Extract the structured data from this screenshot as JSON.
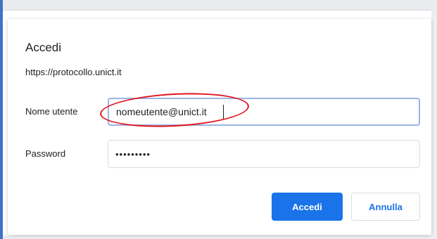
{
  "dialog": {
    "title": "Accedi",
    "origin": "https://protocollo.unict.it",
    "username": {
      "label": "Nome utente",
      "value": "nomeutente@unict.it"
    },
    "password": {
      "label": "Password",
      "value": "•••••••••"
    },
    "buttons": {
      "submit": "Accedi",
      "cancel": "Annulla"
    }
  },
  "colors": {
    "primary": "#1a73e8",
    "annotation": "#e0131b",
    "frame_accent": "#3f73c8"
  }
}
